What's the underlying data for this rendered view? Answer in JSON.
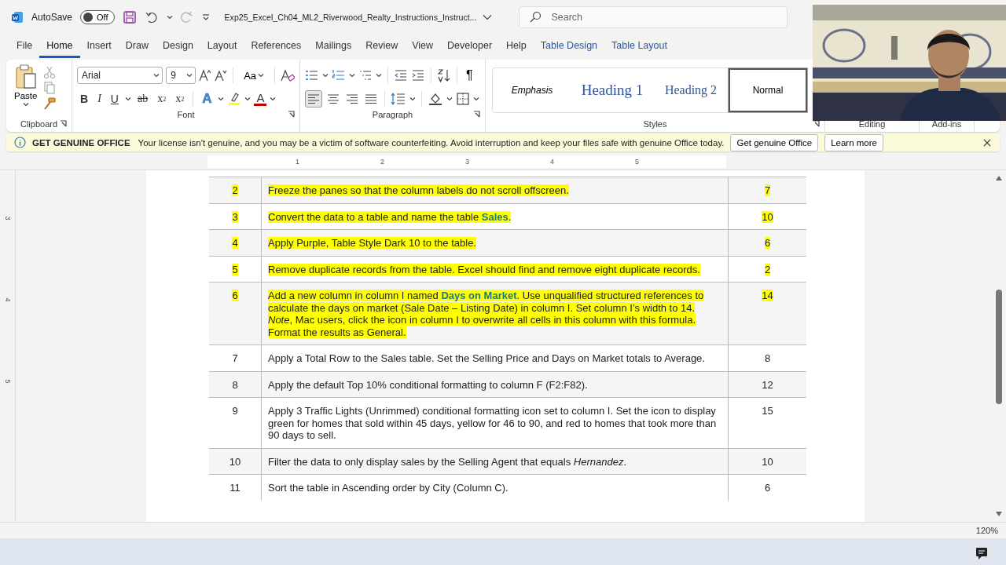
{
  "title_bar": {
    "autosave_label": "AutoSave",
    "autosave": {
      "on": false,
      "label": "Off"
    },
    "document_title": "Exp25_Excel_Ch04_ML2_Riverwood_Realty_Instructions_Instruct...",
    "search": {
      "placeholder": "Search"
    }
  },
  "tabs": [
    {
      "label": "File",
      "selected": false,
      "kind": "normal"
    },
    {
      "label": "Home",
      "selected": true,
      "kind": "normal"
    },
    {
      "label": "Insert",
      "selected": false,
      "kind": "normal"
    },
    {
      "label": "Draw",
      "selected": false,
      "kind": "normal"
    },
    {
      "label": "Design",
      "selected": false,
      "kind": "normal"
    },
    {
      "label": "Layout",
      "selected": false,
      "kind": "normal"
    },
    {
      "label": "References",
      "selected": false,
      "kind": "normal"
    },
    {
      "label": "Mailings",
      "selected": false,
      "kind": "normal"
    },
    {
      "label": "Review",
      "selected": false,
      "kind": "normal"
    },
    {
      "label": "View",
      "selected": false,
      "kind": "normal"
    },
    {
      "label": "Developer",
      "selected": false,
      "kind": "normal"
    },
    {
      "label": "Help",
      "selected": false,
      "kind": "normal"
    },
    {
      "label": "Table Design",
      "selected": false,
      "kind": "contextual"
    },
    {
      "label": "Table Layout",
      "selected": false,
      "kind": "contextual"
    }
  ],
  "ribbon": {
    "clipboard": {
      "paste_label": "Paste",
      "label": "Clipboard"
    },
    "font": {
      "name": "Arial",
      "size": "9",
      "change_case": "Aa",
      "buttons": [
        {
          "label": "B",
          "kind": "bold"
        },
        {
          "label": "I",
          "kind": "italic"
        },
        {
          "label": "U",
          "kind": "underline"
        },
        {
          "label": "ab",
          "kind": "strike"
        },
        {
          "label": "x",
          "index": "2",
          "kind": "subscript"
        },
        {
          "label": "x",
          "index": "2",
          "kind": "superscript"
        },
        {
          "label": "A",
          "kind": "effects"
        },
        {
          "label": "A",
          "kind": "color"
        }
      ],
      "label": "Font"
    },
    "paragraph": {
      "pilcrow": "¶",
      "label": "Paragraph"
    },
    "styles": {
      "items": [
        {
          "label": "Emphasis",
          "kind": "emphasis",
          "selected": false
        },
        {
          "label": "Heading 1",
          "kind": "heading1",
          "selected": false
        },
        {
          "label": "Heading 2",
          "kind": "heading2",
          "selected": false
        },
        {
          "label": "Normal",
          "kind": "normal",
          "selected": true
        }
      ],
      "label": "Styles"
    },
    "editing": {
      "label": "Editing"
    },
    "add_ins": {
      "label": "Add-ins"
    }
  },
  "notice": {
    "title": "GET GENUINE OFFICE",
    "message": "Your license isn't genuine, and you may be a victim of software counterfeiting. Avoid interruption and keep your files safe with genuine Office today.",
    "buttons": [
      "Get genuine Office",
      "Learn more"
    ]
  },
  "ruler": {
    "marks": [
      "1",
      "2",
      "3",
      "4",
      "5"
    ]
  },
  "vertical_ruler": {
    "marks": [
      "3",
      "4",
      "5"
    ]
  },
  "table": {
    "rows": [
      {
        "number": "2",
        "text": [
          "Freeze the panes so that the column labels do not scroll offscreen."
        ],
        "points": "7",
        "highlighted": true
      },
      {
        "number": "3",
        "text": [
          "Convert the data to a table and name the table **Sales**."
        ],
        "points": "10",
        "highlighted": true
      },
      {
        "number": "4",
        "text": [
          "Apply Purple, Table Style Dark 10 to the table."
        ],
        "points": "6",
        "highlighted": true
      },
      {
        "number": "5",
        "text": [
          "Remove duplicate records from the table. Excel should find and remove eight duplicate records."
        ],
        "points": "2",
        "highlighted": true
      },
      {
        "number": "6",
        "text": [
          "Add a new column in column I named **Days on Market**. Use unqualified structured references to calculate the days on market (Sale Date – Listing Date) in column I. Set column I’s width to 14.",
          "*Note*, Mac users, click the icon in column I to overwrite all cells in this column with this formula. Format the results as General."
        ],
        "points": "14",
        "highlighted": true
      },
      {
        "number": "7",
        "text": [
          "Apply a Total Row to the Sales table. Set the Selling Price and Days on Market totals to Average."
        ],
        "points": "8",
        "highlighted": false
      },
      {
        "number": "8",
        "text": [
          "Apply the default Top 10% conditional formatting to column F (F2:F82)."
        ],
        "points": "12",
        "highlighted": false
      },
      {
        "number": "9",
        "text": [
          "Apply 3 Traffic Lights (Unrimmed) conditional formatting icon set to column I. Set the icon to display green for homes that sold within 45 days, yellow for 46 to 90, and red to homes that took more than 90 days to sell."
        ],
        "points": "15",
        "highlighted": false
      },
      {
        "number": "10",
        "text": [
          "Filter the data to only display sales by the Selling Agent that equals *Hernandez*."
        ],
        "points": "10",
        "highlighted": false
      },
      {
        "number": "11",
        "text": [
          "Sort the table in Ascending order by City (Column C)."
        ],
        "points": "6",
        "highlighted": false
      }
    ]
  },
  "status_bar": {
    "zoom": "120%"
  }
}
